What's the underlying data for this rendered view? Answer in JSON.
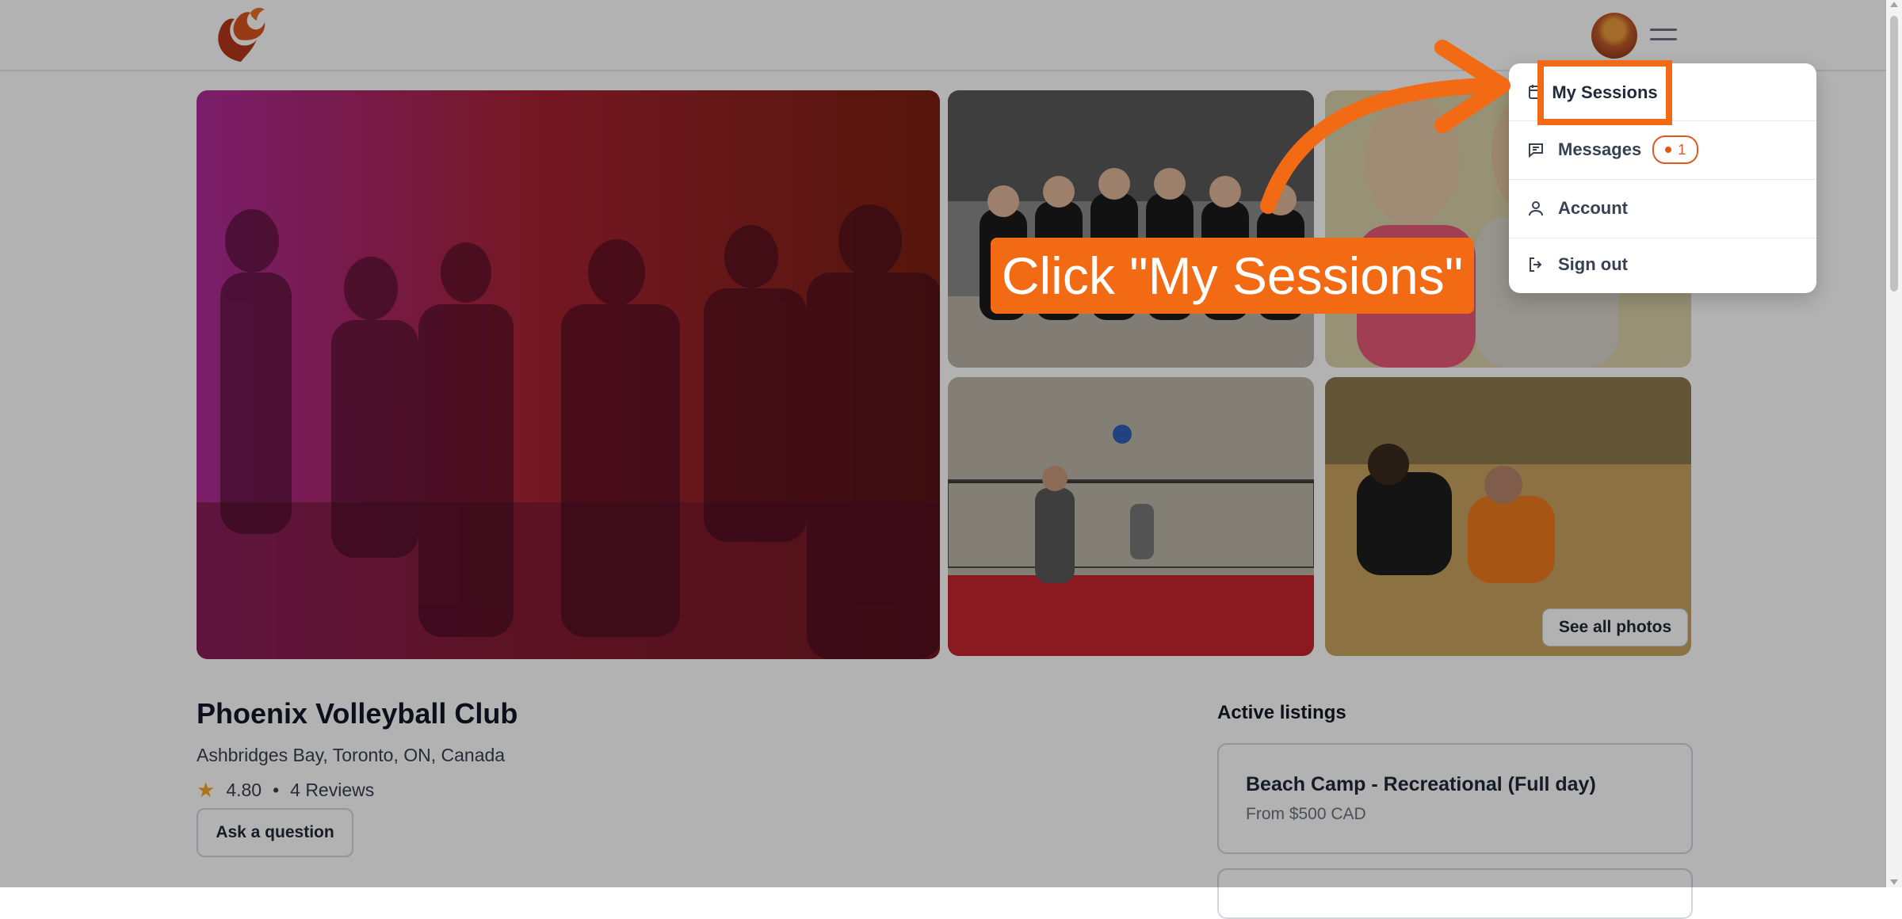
{
  "header": {
    "logo_icon": "phoenix-logo-icon",
    "avatar_icon": "user-avatar",
    "menu_icon": "hamburger-icon"
  },
  "gallery": {
    "see_all_label": "See all photos"
  },
  "club": {
    "name": "Phoenix Volleyball Club",
    "location": "Ashbridges Bay, Toronto, ON, Canada",
    "rating": "4.80",
    "separator": "•",
    "reviews": "4 Reviews",
    "ask_label": "Ask a question"
  },
  "listings": {
    "title": "Active listings",
    "items": [
      {
        "name": "Beach Camp - Recreational (Full day)",
        "price": "From $500 CAD"
      }
    ]
  },
  "user_menu": {
    "items": [
      {
        "label": "My Sessions",
        "icon": "calendar-icon"
      },
      {
        "label": "Messages",
        "icon": "chat-icon",
        "badge": "1"
      },
      {
        "label": "Account",
        "icon": "user-icon"
      },
      {
        "label": "Sign out",
        "icon": "sign-out-icon"
      }
    ]
  },
  "annotation": {
    "text": "Click \"My Sessions\""
  },
  "colors": {
    "accent": "#f26a13",
    "badge": "#e2581c",
    "star": "#f5a623",
    "overlay": "rgba(0,0,0,0.30)"
  }
}
